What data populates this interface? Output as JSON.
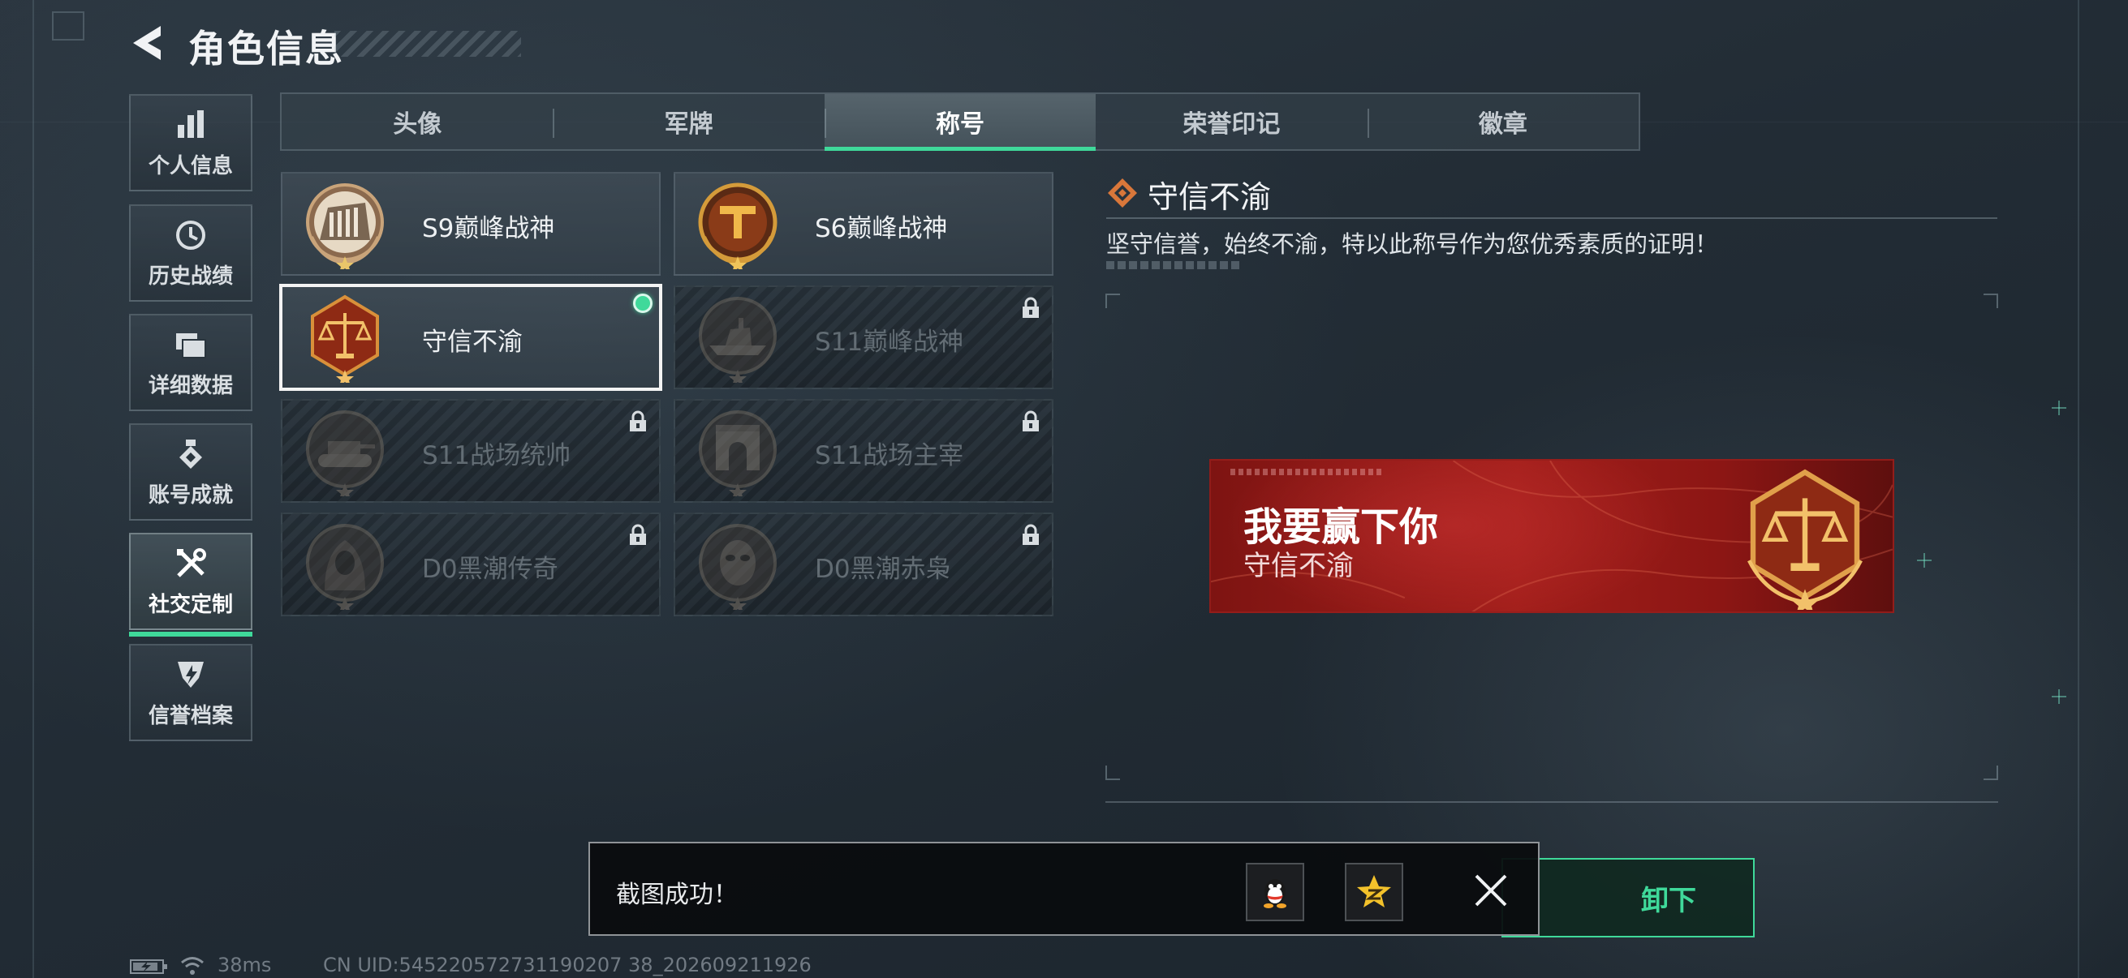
{
  "header": {
    "title": "角色信息"
  },
  "sidebar": {
    "items": [
      {
        "label": "个人信息",
        "icon": "bar-chart-icon",
        "active": false
      },
      {
        "label": "历史战绩",
        "icon": "clock-icon",
        "active": false
      },
      {
        "label": "详细数据",
        "icon": "folder-icon",
        "active": false
      },
      {
        "label": "账号成就",
        "icon": "medal-icon",
        "active": false
      },
      {
        "label": "社交定制",
        "icon": "tools-icon",
        "active": true
      },
      {
        "label": "信誉档案",
        "icon": "credit-emblem-icon",
        "active": false
      }
    ]
  },
  "tabs": [
    {
      "label": "头像",
      "active": false
    },
    {
      "label": "军牌",
      "active": false
    },
    {
      "label": "称号",
      "active": true
    },
    {
      "label": "荣誉印记",
      "active": false
    },
    {
      "label": "徽章",
      "active": false
    }
  ],
  "titles": [
    {
      "name": "S9巅峰战神",
      "emblem": "building-emblem-icon",
      "locked": false,
      "selected": false
    },
    {
      "name": "S6巅峰战神",
      "emblem": "t-shield-emblem-icon",
      "locked": false,
      "selected": false
    },
    {
      "name": "守信不渝",
      "emblem": "scales-emblem-icon",
      "locked": false,
      "selected": true,
      "equipped": true
    },
    {
      "name": "S11巅峰战神",
      "emblem": "ship-emblem-icon",
      "locked": true,
      "selected": false
    },
    {
      "name": "S11战场统帅",
      "emblem": "tank-emblem-icon",
      "locked": true,
      "selected": false
    },
    {
      "name": "S11战场主宰",
      "emblem": "arch-emblem-icon",
      "locked": true,
      "selected": false
    },
    {
      "name": "D0黑潮传奇",
      "emblem": "hooded-figure-emblem-icon",
      "locked": true,
      "selected": false
    },
    {
      "name": "D0黑潮赤枭",
      "emblem": "mask-emblem-icon",
      "locked": true,
      "selected": false
    }
  ],
  "detail": {
    "name": "守信不渝",
    "description": "坚守信誉，始终不渝，特以此称号作为您优秀素质的证明！"
  },
  "banner": {
    "player_name": "我要赢下你",
    "title": "守信不渝"
  },
  "unequip_button": {
    "label": "卸下"
  },
  "toast": {
    "message": "截图成功！",
    "share_icons": [
      "qq-penguin-icon",
      "qzone-star-icon"
    ]
  },
  "status": {
    "ping": "38ms",
    "uid": "CN UID:545220572731190207 38_202609211926"
  },
  "colors": {
    "accent_green": "#3fd99a",
    "banner_red": "#a11e1a",
    "background": "#222c35"
  }
}
